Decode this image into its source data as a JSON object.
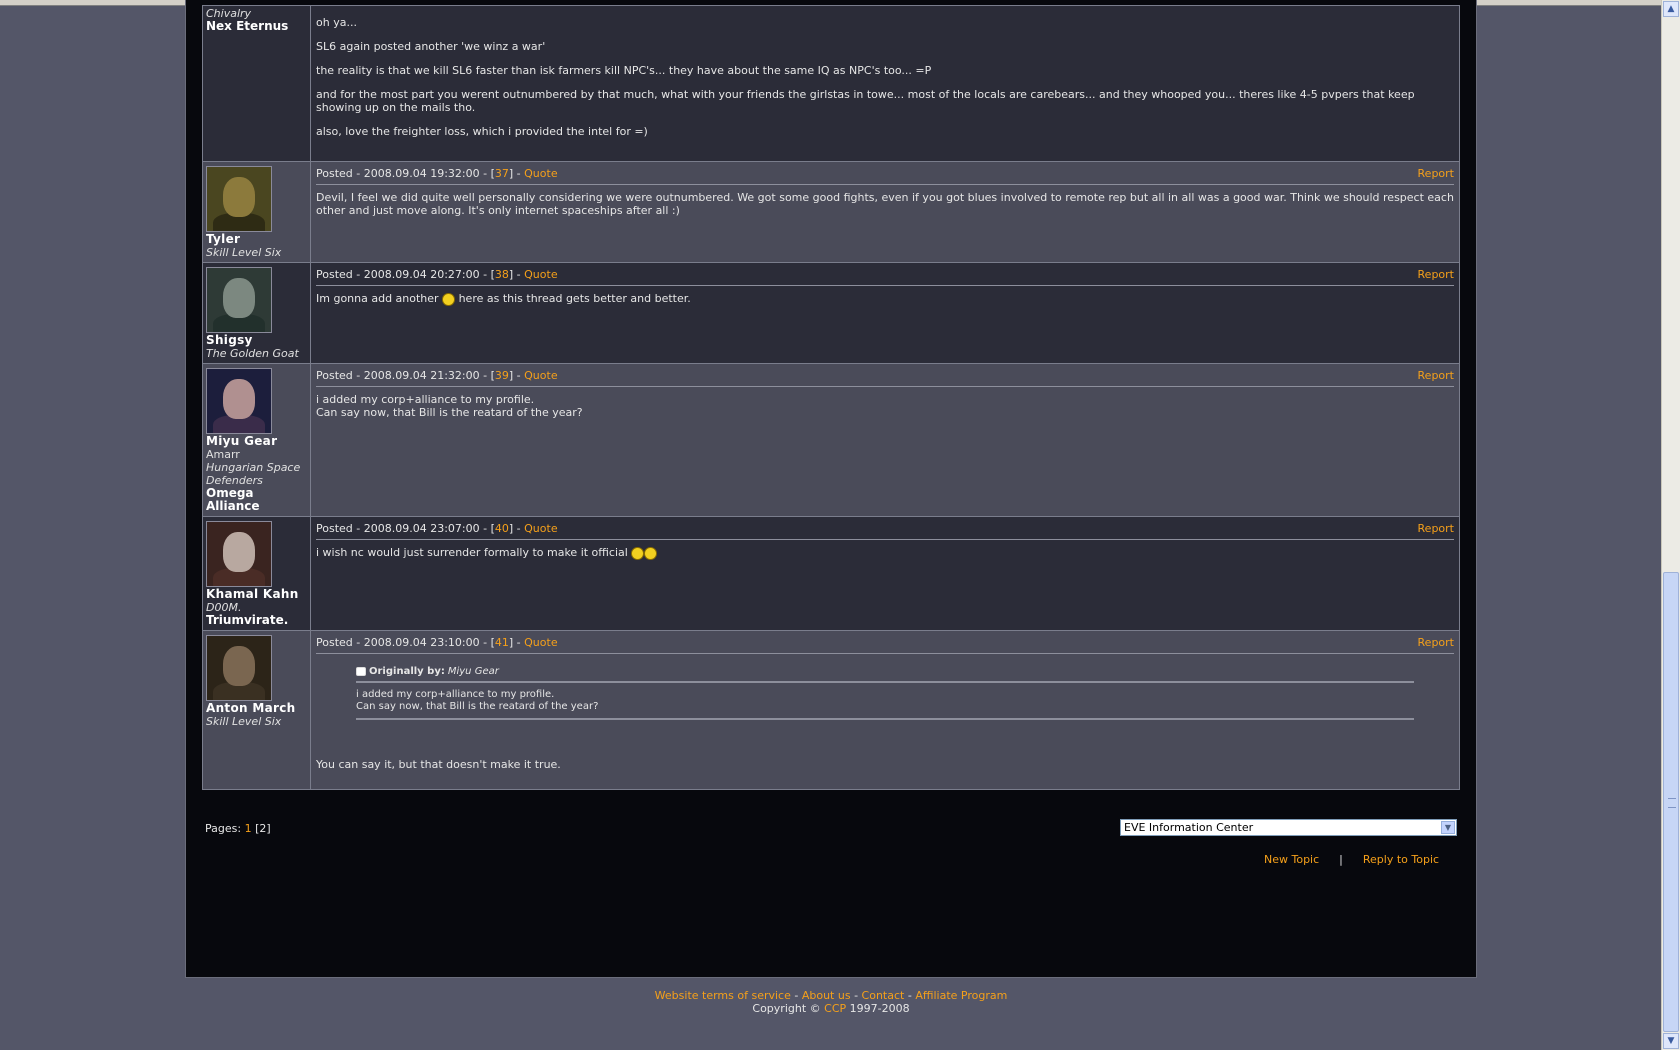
{
  "posts": [
    {
      "author_lines": [
        {
          "text": "Chivalry",
          "style": "ital"
        },
        {
          "text": "Nex Eternus",
          "style": "bold"
        }
      ],
      "paragraphs": [
        "oh ya...",
        "SL6 again posted another 'we winz a war'",
        "the reality is that we kill SL6 faster than isk farmers kill NPC's... they have about the same IQ as NPC's too... =P",
        "and for the most part you werent outnumbered by that much, what with your friends the girlstas in towe... most of the locals are carebears... and they whooped you... theres like 4-5 pvpers that keep showing up on the mails tho.",
        "also, love the freighter loss, which i provided the intel for =)"
      ]
    },
    {
      "posted": "Posted - 2008.09.04 19:32:00 - [",
      "num": "37",
      "quote": "Quote",
      "report": "Report",
      "name": "Tyler",
      "author_lines": [
        {
          "text": "Skill Level Six",
          "style": "ital"
        }
      ],
      "paragraphs": [
        "Devil, I feel we did quite well personally considering we were outnumbered. We got some good fights, even if you got blues involved to remote rep but all in all was a good war. Think we should respect each other and just move along. It's only internet spaceships after all :)"
      ]
    },
    {
      "posted": "Posted - 2008.09.04 20:27:00 - [",
      "num": "38",
      "quote": "Quote",
      "report": "Report",
      "name": "Shigsy",
      "author_lines": [
        {
          "text": "The Golden Goat",
          "style": "ital"
        }
      ],
      "text_before": "Im gonna add another ",
      "text_after": " here as this thread gets better and better."
    },
    {
      "posted": "Posted - 2008.09.04 21:32:00 - [",
      "num": "39",
      "quote": "Quote",
      "report": "Report",
      "name": "Miyu Gear",
      "author_lines": [
        {
          "text": "Amarr",
          "style": "plain"
        },
        {
          "text": "Hungarian Space Defenders",
          "style": "ital"
        },
        {
          "text": "Omega Alliance",
          "style": "bold"
        }
      ],
      "lines": [
        "i added my corp+alliance to my profile.",
        "Can say now, that Bill is the reatard of the year?"
      ]
    },
    {
      "posted": "Posted - 2008.09.04 23:07:00 - [",
      "num": "40",
      "quote": "Quote",
      "report": "Report",
      "name": "Khamal Kahn",
      "author_lines": [
        {
          "text": "D00M.",
          "style": "ital"
        },
        {
          "text": "Triumvirate.",
          "style": "bold"
        }
      ],
      "text_before": "i wish nc would just surrender formally to make it official "
    },
    {
      "posted": "Posted - 2008.09.04 23:10:00 - [",
      "num": "41",
      "quote": "Quote",
      "report": "Report",
      "name": "Anton March",
      "author_lines": [
        {
          "text": "Skill Level Six",
          "style": "ital"
        }
      ],
      "quote_label": "Originally by:",
      "quote_author": "Miyu Gear",
      "quote_lines": [
        "i added my corp+alliance to my profile.",
        "Can say now, that Bill is the reatard of the year?"
      ],
      "reply": "You can say it, but that doesn't make it true."
    }
  ],
  "pagination": {
    "label": "Pages: ",
    "page1": "1",
    "page2": "[2]"
  },
  "forum_select": {
    "value": "EVE Information Center"
  },
  "actions": {
    "new_topic": "New Topic",
    "separator": "|",
    "reply": "Reply to Topic"
  },
  "footer": {
    "terms": "Website terms of service",
    "about": "About us",
    "contact": "Contact",
    "affiliate": "Affiliate Program",
    "dash": " - ",
    "copyright_prefix": "Copyright © ",
    "ccp": "CCP",
    "years": " 1997-2008"
  },
  "colors": {
    "accent": "#f5a01a",
    "page_bg": "#545668",
    "panel_dark": "#2b2c38",
    "panel_light": "#4a4b59"
  }
}
